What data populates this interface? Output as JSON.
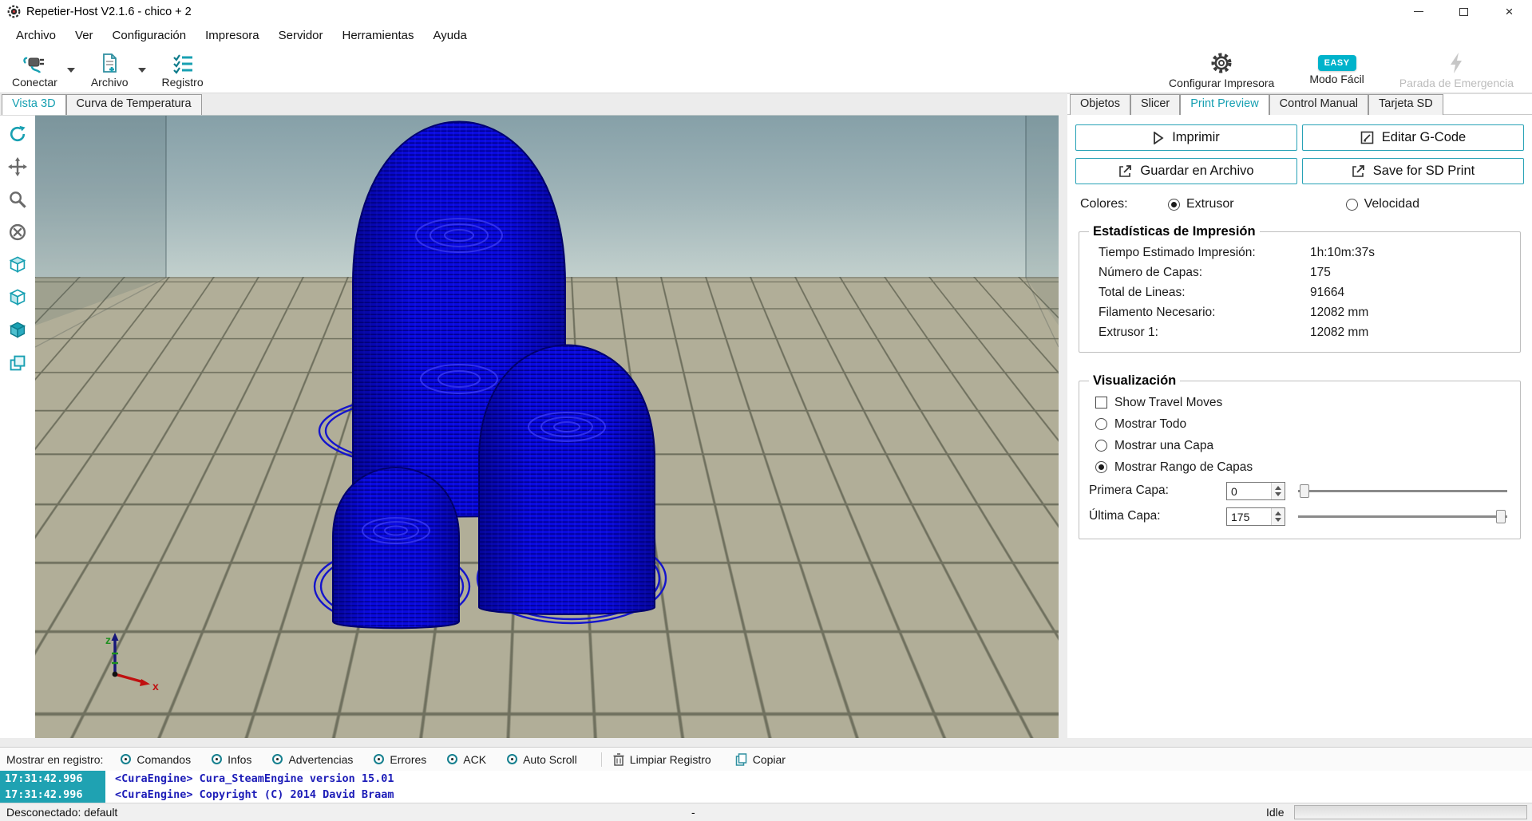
{
  "accent_color": "#16a0b2",
  "window": {
    "title": "Repetier-Host V2.1.6 - chico + 2"
  },
  "menu": {
    "items": [
      "Archivo",
      "Ver",
      "Configuración",
      "Impresora",
      "Servidor",
      "Herramientas",
      "Ayuda"
    ]
  },
  "toolbar": {
    "connect": "Conectar",
    "file": "Archivo",
    "log": "Registro",
    "configure_printer": "Configurar Impresora",
    "easy_badge": "EASY",
    "easy_mode": "Modo Fácil",
    "emergency_stop": "Parada de Emergencia"
  },
  "view_tabs": {
    "vista3d": "Vista 3D",
    "temp_curve": "Curva de Temperatura",
    "active": "Vista 3D"
  },
  "right_tabs": [
    "Objetos",
    "Slicer",
    "Print Preview",
    "Control Manual",
    "Tarjeta SD"
  ],
  "right_tabs_active": "Print Preview",
  "actions": {
    "print": "Imprimir",
    "edit_gcode": "Editar G-Code",
    "save_file": "Guardar en Archivo",
    "save_sd": "Save for SD Print"
  },
  "colores_row": {
    "label": "Colores:",
    "extruder": "Extrusor",
    "speed": "Velocidad",
    "selected": "Extrusor"
  },
  "stats": {
    "title": "Estadísticas de Impresión",
    "rows": [
      {
        "label": "Tiempo Estimado Impresión:",
        "value": "1h:10m:37s"
      },
      {
        "label": "Número de Capas:",
        "value": "175"
      },
      {
        "label": "Total de Lineas:",
        "value": "91664"
      },
      {
        "label": "Filamento Necesario:",
        "value": "12082 mm"
      },
      {
        "label": "Extrusor 1:",
        "value": "12082 mm"
      }
    ]
  },
  "visualization": {
    "title": "Visualización",
    "travel": "Show Travel Moves",
    "travel_checked": false,
    "show_all": "Mostrar Todo",
    "show_one": "Mostrar una Capa",
    "show_range": "Mostrar Rango de Capas",
    "display_mode": "Mostrar Rango de Capas",
    "first_layer": {
      "label": "Primera Capa:",
      "value": "0"
    },
    "last_layer": {
      "label": "Última Capa:",
      "value": "175"
    }
  },
  "log_bar": {
    "label": "Mostrar en registro:",
    "toggles": [
      "Comandos",
      "Infos",
      "Advertencias",
      "Errores",
      "ACK",
      "Auto Scroll"
    ],
    "clear": "Limpiar Registro",
    "copy": "Copiar"
  },
  "log": [
    {
      "time": "17:31:42.996",
      "text": "<CuraEngine> Cura_SteamEngine version 15.01"
    },
    {
      "time": "17:31:42.996",
      "text": "<CuraEngine> Copyright (C) 2014 David Braam"
    }
  ],
  "status": {
    "left": "Desconectado: default",
    "center": "-",
    "right": "Idle"
  },
  "viewport": {
    "axis": {
      "x": "x",
      "z": "z"
    }
  }
}
